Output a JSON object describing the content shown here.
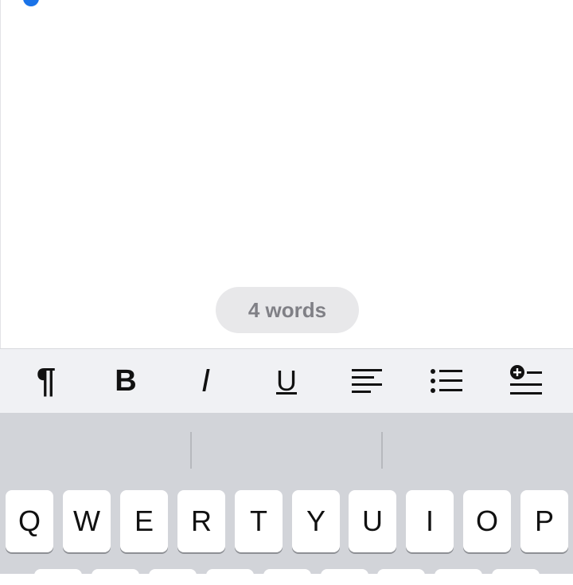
{
  "document": {
    "word_count_label": "4 words"
  },
  "format_toolbar": {
    "tools": [
      {
        "name": "paragraph-style-button",
        "icon": "pilcrow-icon",
        "glyph": "¶"
      },
      {
        "name": "bold-button",
        "icon": "bold-icon",
        "glyph": "B"
      },
      {
        "name": "italic-button",
        "icon": "italic-icon",
        "glyph": "I"
      },
      {
        "name": "underline-button",
        "icon": "underline-icon",
        "glyph": "U"
      },
      {
        "name": "align-button",
        "icon": "align-left-icon"
      },
      {
        "name": "bulleted-list-button",
        "icon": "bulleted-list-icon"
      },
      {
        "name": "insert-button",
        "icon": "insert-plus-list-icon"
      }
    ]
  },
  "keyboard": {
    "row1": [
      "Q",
      "W",
      "E",
      "R",
      "T",
      "Y",
      "U",
      "I",
      "O",
      "P"
    ]
  },
  "colors": {
    "accent": "#1a73e8",
    "toolbar_bg": "#f0f1f4",
    "keyboard_bg": "#d2d4d9"
  }
}
